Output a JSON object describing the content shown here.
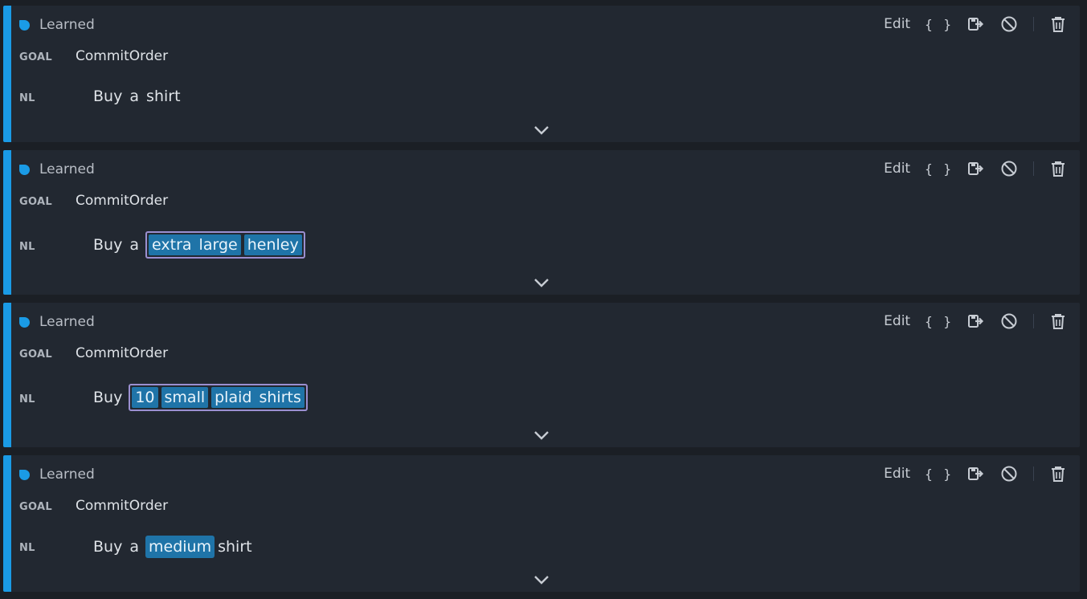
{
  "colors": {
    "accent": "#1a9be6",
    "card_bg": "#222831",
    "page_bg": "#1b1f25",
    "token_bg": "#1f74a8",
    "group_border": "#9b8fd0"
  },
  "actions": {
    "edit_label": "Edit",
    "json_label": "{ }",
    "export_icon": "export-icon",
    "disable_icon": "ban-icon",
    "delete_icon": "trash-icon"
  },
  "cards": [
    {
      "status": "Learned",
      "goal_label": "GOAL",
      "goal": "CommitOrder",
      "nl_label": "NL",
      "nl_text": "Buy a shirt"
    },
    {
      "status": "Learned",
      "goal_label": "GOAL",
      "goal": "CommitOrder",
      "nl_label": "NL",
      "nl_prefix": "Buy a",
      "nl_tokens": [
        "extra large",
        "henley"
      ]
    },
    {
      "status": "Learned",
      "goal_label": "GOAL",
      "goal": "CommitOrder",
      "nl_label": "NL",
      "nl_prefix": "Buy",
      "nl_tokens": [
        "10",
        "small",
        "plaid shirts"
      ]
    },
    {
      "status": "Learned",
      "goal_label": "GOAL",
      "goal": "CommitOrder",
      "nl_label": "NL",
      "nl_prefix": "Buy a",
      "nl_slot": "medium",
      "nl_suffix": "shirt"
    }
  ]
}
